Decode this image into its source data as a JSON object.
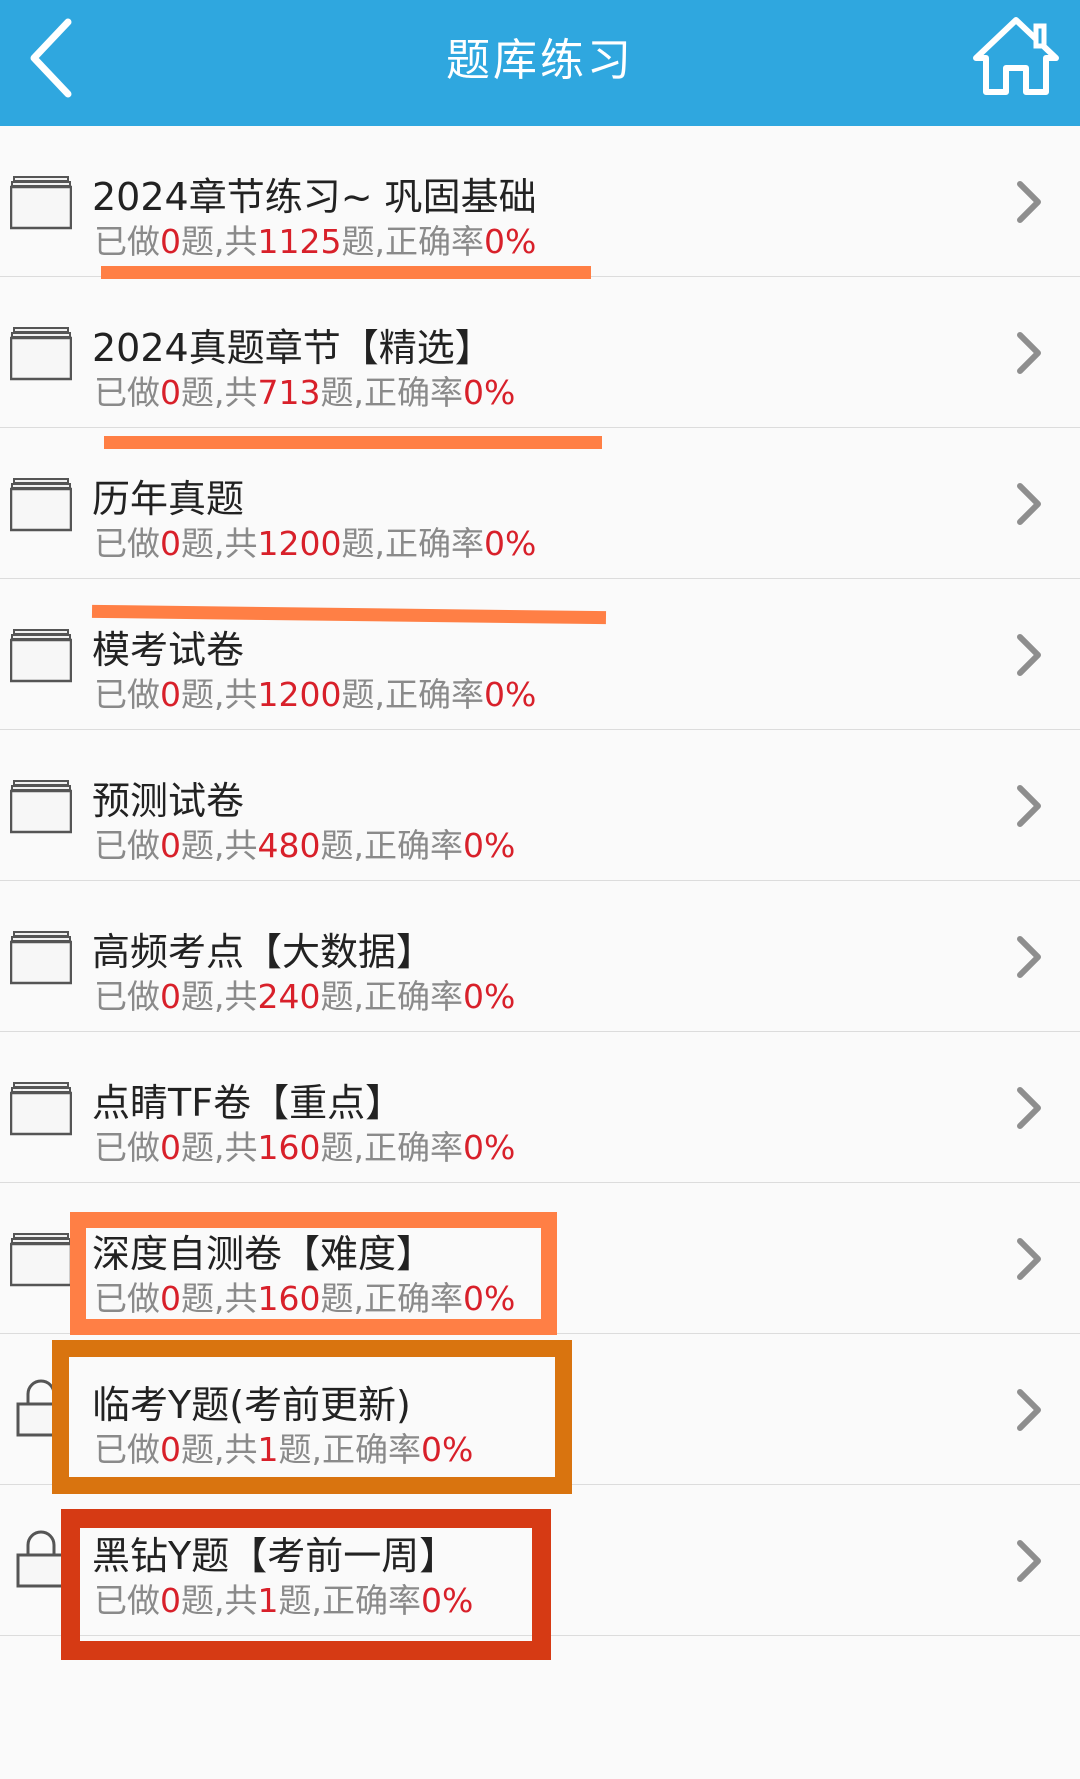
{
  "header": {
    "title": "题库练习",
    "back_icon": "back-chevron-icon",
    "home_icon": "home-icon",
    "background": "#2fa7df"
  },
  "stats_labels": {
    "done_prefix": "已做",
    "done_suffix": "题,共",
    "total_suffix": "题,正确率"
  },
  "rows": [
    {
      "title": "2024章节练习~ 巩固基础",
      "done": "0",
      "total": "1125",
      "rate": "0%",
      "icon": "folder-icon"
    },
    {
      "title": "2024真题章节【精选】",
      "done": "0",
      "total": "713",
      "rate": "0%",
      "icon": "folder-icon"
    },
    {
      "title": "历年真题",
      "done": "0",
      "total": "1200",
      "rate": "0%",
      "icon": "folder-icon"
    },
    {
      "title": "模考试卷",
      "done": "0",
      "total": "1200",
      "rate": "0%",
      "icon": "folder-icon"
    },
    {
      "title": "预测试卷",
      "done": "0",
      "total": "480",
      "rate": "0%",
      "icon": "folder-icon"
    },
    {
      "title": "高频考点【大数据】",
      "done": "0",
      "total": "240",
      "rate": "0%",
      "icon": "folder-icon"
    },
    {
      "title": "点睛TF卷【重点】",
      "done": "0",
      "total": "160",
      "rate": "0%",
      "icon": "folder-icon"
    },
    {
      "title": "深度自测卷【难度】",
      "done": "0",
      "total": "160",
      "rate": "0%",
      "icon": "folder-icon"
    },
    {
      "title": "临考Y题(考前更新)",
      "done": "0",
      "total": "1",
      "rate": "0%",
      "icon": "lock-icon"
    },
    {
      "title": "黑钻Y题【考前一周】",
      "done": "0",
      "total": "1",
      "rate": "0%",
      "icon": "lock-icon"
    }
  ],
  "colors": {
    "accent": "#2fa7df",
    "highlight_red": "#d8202a",
    "annotation_orange": "#ff7f45",
    "annotation_dark_orange": "#d9740f",
    "annotation_red": "#d63a14"
  }
}
